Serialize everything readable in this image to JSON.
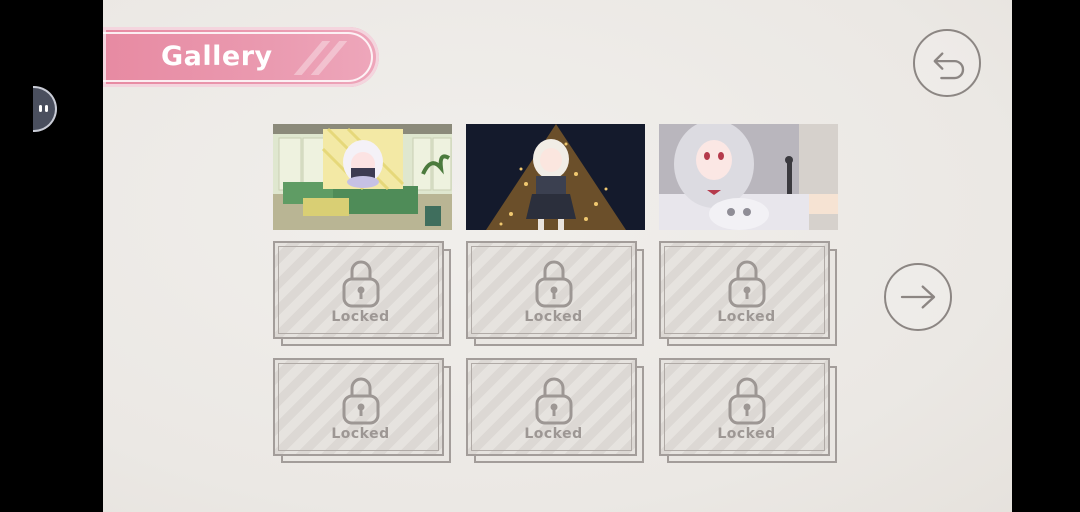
{
  "header": {
    "title": "Gallery"
  },
  "buttons": {
    "back_icon": "undo-arrow-icon",
    "next_icon": "arrow-right-icon"
  },
  "gallery": {
    "unlocked": [
      {
        "icon": "room-with-chibi-picture-thumbnail"
      },
      {
        "icon": "christmas-tree-character-thumbnail"
      },
      {
        "icon": "bedroom-character-thumbnail"
      }
    ],
    "locked": [
      {
        "label": "Locked"
      },
      {
        "label": "Locked"
      },
      {
        "label": "Locked"
      },
      {
        "label": "Locked"
      },
      {
        "label": "Locked"
      },
      {
        "label": "Locked"
      }
    ]
  },
  "colors": {
    "banner": "#e78aa2",
    "background": "#ebe8e4",
    "outline": "#a39d9a"
  }
}
